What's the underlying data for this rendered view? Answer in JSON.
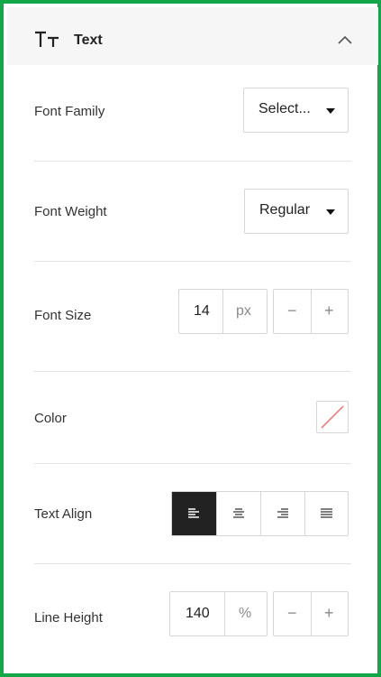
{
  "header": {
    "title": "Text",
    "icon": "text-type-icon",
    "collapse_icon": "chevron-up-icon"
  },
  "font_family": {
    "label": "Font Family",
    "value": "Select..."
  },
  "font_weight": {
    "label": "Font Weight",
    "value": "Regular"
  },
  "font_size": {
    "label": "Font Size",
    "value": "14",
    "unit": "px",
    "minus": "−",
    "plus": "+"
  },
  "color": {
    "label": "Color",
    "swatch_icon": "no-color-swatch-icon"
  },
  "text_align": {
    "label": "Text Align",
    "options": [
      "align-left-icon",
      "align-center-icon",
      "align-right-icon",
      "align-justify-icon"
    ],
    "selected": "align-left-icon"
  },
  "line_height": {
    "label": "Line Height",
    "value": "140",
    "unit": "%",
    "minus": "−",
    "plus": "+"
  },
  "colors": {
    "accent_border": "#12a84a",
    "active_align_bg": "#222222"
  }
}
